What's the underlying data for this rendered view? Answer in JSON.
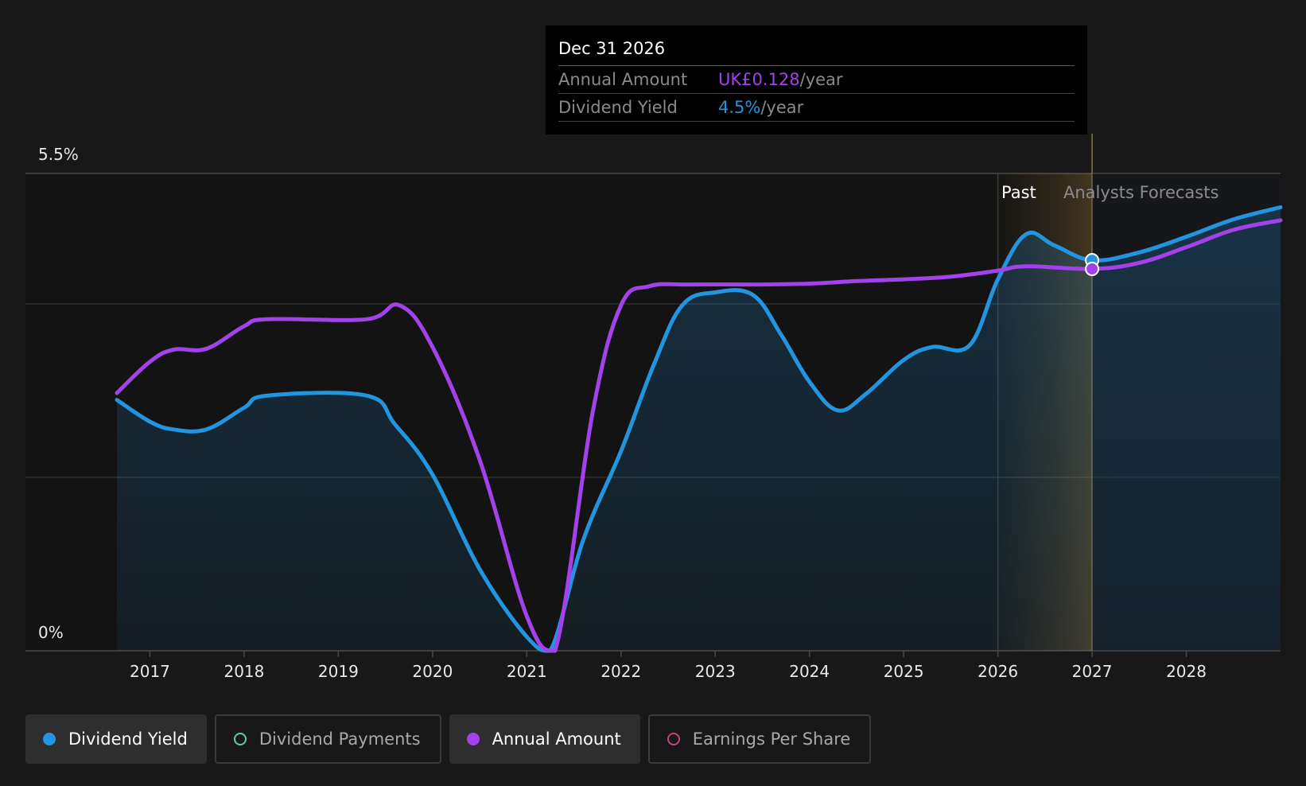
{
  "chart_data": {
    "type": "line",
    "title": "",
    "xlabel": "",
    "ylabel": "",
    "y_unit": "%",
    "ylim": [
      0,
      5.5
    ],
    "y_tick_labels": [
      "5.5%",
      "0%"
    ],
    "x_ticks": [
      "2017",
      "2018",
      "2019",
      "2020",
      "2021",
      "2022",
      "2023",
      "2024",
      "2025",
      "2026",
      "2027",
      "2028"
    ],
    "grid": true,
    "legend_position": "bottom",
    "region_labels": {
      "past": "Past",
      "forecast": "Analysts Forecasts"
    },
    "past_region": [
      2026.0,
      2027.0
    ],
    "series": [
      {
        "name": "Dividend Yield",
        "color": "#2394df",
        "area": true,
        "points": [
          [
            2016.65,
            2.89
          ],
          [
            2017.0,
            2.64
          ],
          [
            2017.25,
            2.55
          ],
          [
            2017.6,
            2.55
          ],
          [
            2018.0,
            2.8
          ],
          [
            2018.25,
            2.94
          ],
          [
            2019.3,
            2.94
          ],
          [
            2019.6,
            2.61
          ],
          [
            2020.0,
            2.03
          ],
          [
            2020.5,
            0.94
          ],
          [
            2021.0,
            0.16
          ],
          [
            2021.25,
            0.0
          ],
          [
            2021.6,
            1.28
          ],
          [
            2022.0,
            2.3
          ],
          [
            2022.35,
            3.3
          ],
          [
            2022.65,
            3.98
          ],
          [
            2023.0,
            4.13
          ],
          [
            2023.4,
            4.1
          ],
          [
            2023.7,
            3.64
          ],
          [
            2024.0,
            3.1
          ],
          [
            2024.3,
            2.77
          ],
          [
            2024.6,
            2.96
          ],
          [
            2025.0,
            3.35
          ],
          [
            2025.3,
            3.5
          ],
          [
            2025.7,
            3.52
          ],
          [
            2026.0,
            4.28
          ],
          [
            2026.3,
            4.8
          ],
          [
            2026.6,
            4.67
          ],
          [
            2027.0,
            4.5
          ],
          [
            2027.5,
            4.59
          ],
          [
            2028.0,
            4.77
          ],
          [
            2028.5,
            4.97
          ],
          [
            2029.0,
            5.11
          ]
        ]
      },
      {
        "name": "Annual Amount",
        "color": "#a341ea",
        "area": false,
        "points": [
          [
            2016.65,
            2.97
          ],
          [
            2017.0,
            3.33
          ],
          [
            2017.25,
            3.47
          ],
          [
            2017.6,
            3.48
          ],
          [
            2018.0,
            3.74
          ],
          [
            2018.25,
            3.82
          ],
          [
            2019.3,
            3.82
          ],
          [
            2019.65,
            3.98
          ],
          [
            2020.0,
            3.5
          ],
          [
            2020.5,
            2.2
          ],
          [
            2021.0,
            0.4
          ],
          [
            2021.3,
            0.0
          ],
          [
            2021.7,
            2.75
          ],
          [
            2022.0,
            3.98
          ],
          [
            2022.3,
            4.2
          ],
          [
            2022.7,
            4.22
          ],
          [
            2023.5,
            4.22
          ],
          [
            2024.0,
            4.23
          ],
          [
            2024.5,
            4.26
          ],
          [
            2025.0,
            4.28
          ],
          [
            2025.5,
            4.31
          ],
          [
            2026.0,
            4.38
          ],
          [
            2026.3,
            4.43
          ],
          [
            2027.0,
            4.4
          ],
          [
            2027.5,
            4.47
          ],
          [
            2028.0,
            4.65
          ],
          [
            2028.5,
            4.85
          ],
          [
            2029.0,
            4.96
          ]
        ]
      }
    ]
  },
  "tooltip": {
    "date": "Dec 31 2026",
    "rows": [
      {
        "label": "Annual Amount",
        "value": "UK£0.128",
        "unit": "/year",
        "color": "#a341ea"
      },
      {
        "label": "Dividend Yield",
        "value": "4.5%",
        "unit": "/year",
        "color": "#2394df"
      }
    ]
  },
  "legend": [
    {
      "label": "Dividend Yield",
      "color": "#2394df",
      "active": true,
      "filled": true
    },
    {
      "label": "Dividend Payments",
      "color": "#5fc9b5",
      "active": false,
      "filled": false
    },
    {
      "label": "Annual Amount",
      "color": "#a341ea",
      "active": true,
      "filled": true
    },
    {
      "label": "Earnings Per Share",
      "color": "#c14383",
      "active": false,
      "filled": false
    }
  ]
}
